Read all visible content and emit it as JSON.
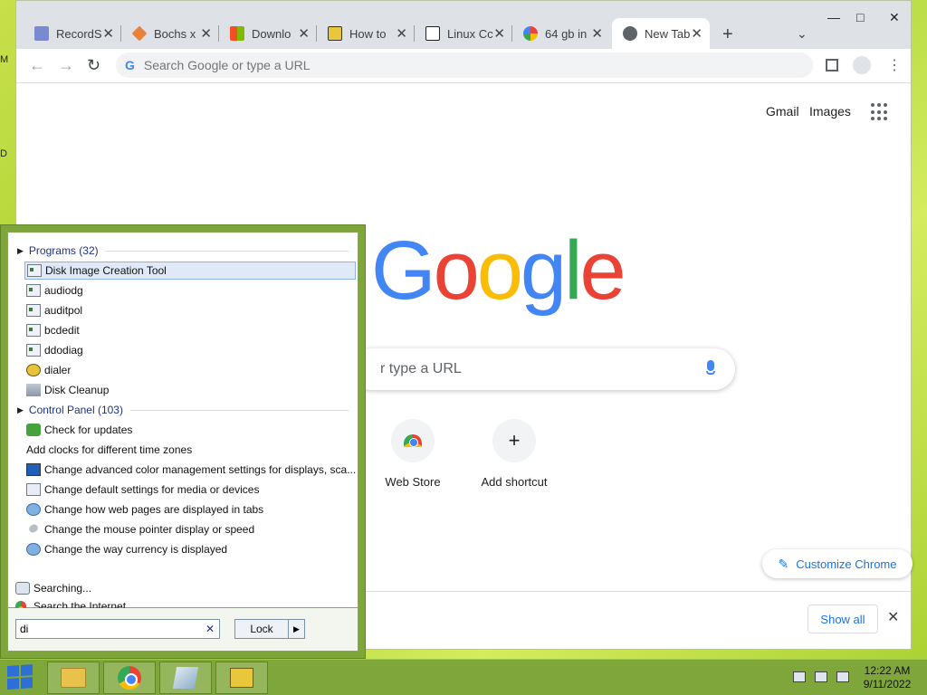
{
  "desktop": {
    "edge_glyph_1": "M",
    "edge_glyph_2": "D"
  },
  "browser": {
    "tabs": [
      {
        "title": "RecordS",
        "close": "✕"
      },
      {
        "title": "Bochs x",
        "close": "✕"
      },
      {
        "title": "Downlo",
        "close": "✕"
      },
      {
        "title": "How to",
        "close": "✕"
      },
      {
        "title": "Linux Cc",
        "close": "✕"
      },
      {
        "title": "64 gb in",
        "close": "✕"
      },
      {
        "title": "New Tab",
        "close": "✕"
      }
    ],
    "new_tab_glyph": "+",
    "tab_list_glyph": "⌄",
    "window_controls": {
      "minimize": "—",
      "maximize": "□",
      "close": "✕"
    },
    "omnibox": {
      "placeholder": "Search Google or type a URL",
      "g_glyph": "G"
    },
    "nav": {
      "back": "←",
      "forward": "→",
      "reload": "↻"
    }
  },
  "ntp": {
    "gmail": "Gmail",
    "images": "Images",
    "logo_letters": [
      "G",
      "o",
      "o",
      "g",
      "l",
      "e"
    ],
    "logo_colors": [
      "#4285f4",
      "#ea4335",
      "#fbbc05",
      "#4285f4",
      "#34a853",
      "#ea4335"
    ],
    "search_visible_text": "r type a URL",
    "shortcuts": [
      {
        "label": "Web Store"
      },
      {
        "label": "Add shortcut",
        "glyph": "+"
      }
    ],
    "customize": "Customize Chrome",
    "customize_glyph": "✎",
    "downloads": {
      "show_all": "Show all",
      "close": "✕"
    }
  },
  "start_menu": {
    "programs_header": "Programs (32)",
    "programs": [
      {
        "label": "Disk Image Creation Tool",
        "icon": "window-icon",
        "selected": true
      },
      {
        "label": "audiodg",
        "icon": "window-icon"
      },
      {
        "label": "auditpol",
        "icon": "window-icon"
      },
      {
        "label": "bcdedit",
        "icon": "window-icon"
      },
      {
        "label": "ddodiag",
        "icon": "window-icon"
      },
      {
        "label": "dialer",
        "icon": "phone-icon"
      },
      {
        "label": "Disk Cleanup",
        "icon": "disk-cleanup-icon"
      }
    ],
    "control_panel_header": "Control Panel (103)",
    "control_panel": [
      {
        "label": "Check for updates",
        "icon": "shield-icon"
      },
      {
        "label": "Add clocks for different time zones",
        "icon": "clock-icon"
      },
      {
        "label": "Change advanced color management settings for displays, sca...",
        "icon": "monitor-icon"
      },
      {
        "label": "Change default settings for media or devices",
        "icon": "media-icon"
      },
      {
        "label": "Change how web pages are displayed in tabs",
        "icon": "globe-icon"
      },
      {
        "label": "Change the mouse pointer display or speed",
        "icon": "mouse-icon"
      },
      {
        "label": "Change the way currency is displayed",
        "icon": "globe-icon"
      }
    ],
    "searching": "Searching...",
    "search_internet": "Search the Internet",
    "search_value": "di",
    "clear_glyph": "✕",
    "lock": "Lock",
    "lock_arrow": "▶"
  },
  "taskbar": {
    "clock_time": "12:22 AM",
    "clock_date": "9/11/2022"
  }
}
